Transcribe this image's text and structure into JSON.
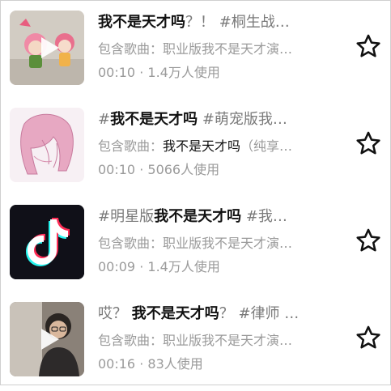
{
  "items": [
    {
      "title_pre": "",
      "title_hl": "我不是天才吗",
      "title_post": "？！ #桐生战…",
      "sub_prefix": "包含歌曲：",
      "sub_hl": "",
      "sub_rest": "职业版我不是天才演…",
      "duration": "00:10",
      "sep": "·",
      "users": "1.4万人使用",
      "thumb_icon": "play-icon",
      "star_icon": "star-icon"
    },
    {
      "title_pre": "#",
      "title_hl": "我不是天才吗",
      "title_post": " #萌宠版我…",
      "sub_prefix": "包含歌曲：",
      "sub_hl": "我不是天才吗",
      "sub_rest": "（纯享…",
      "duration": "00:10",
      "sep": "·",
      "users": "5066人使用",
      "thumb_icon": "anime-character-image",
      "star_icon": "star-icon"
    },
    {
      "title_pre": "#明星版",
      "title_hl": "我不是天才吗",
      "title_post": " #我…",
      "sub_prefix": "包含歌曲：",
      "sub_hl": "",
      "sub_rest": "职业版我不是天才演…",
      "duration": "00:09",
      "sep": "·",
      "users": "1.4万人使用",
      "thumb_icon": "tiktok-logo-icon",
      "star_icon": "star-icon"
    },
    {
      "title_pre": "哎？ ",
      "title_hl": "我不是天才吗",
      "title_post": "？ #律师 …",
      "sub_prefix": "包含歌曲：",
      "sub_hl": "",
      "sub_rest": "职业版我不是天才演…",
      "duration": "00:16",
      "sep": "·",
      "users": "83人使用",
      "thumb_icon": "play-icon",
      "star_icon": "star-icon"
    }
  ],
  "colors": {
    "highlight_text": "#111111",
    "secondary_text": "#9a9a9a",
    "title_text": "#7a7a7a",
    "star_stroke": "#111111"
  }
}
